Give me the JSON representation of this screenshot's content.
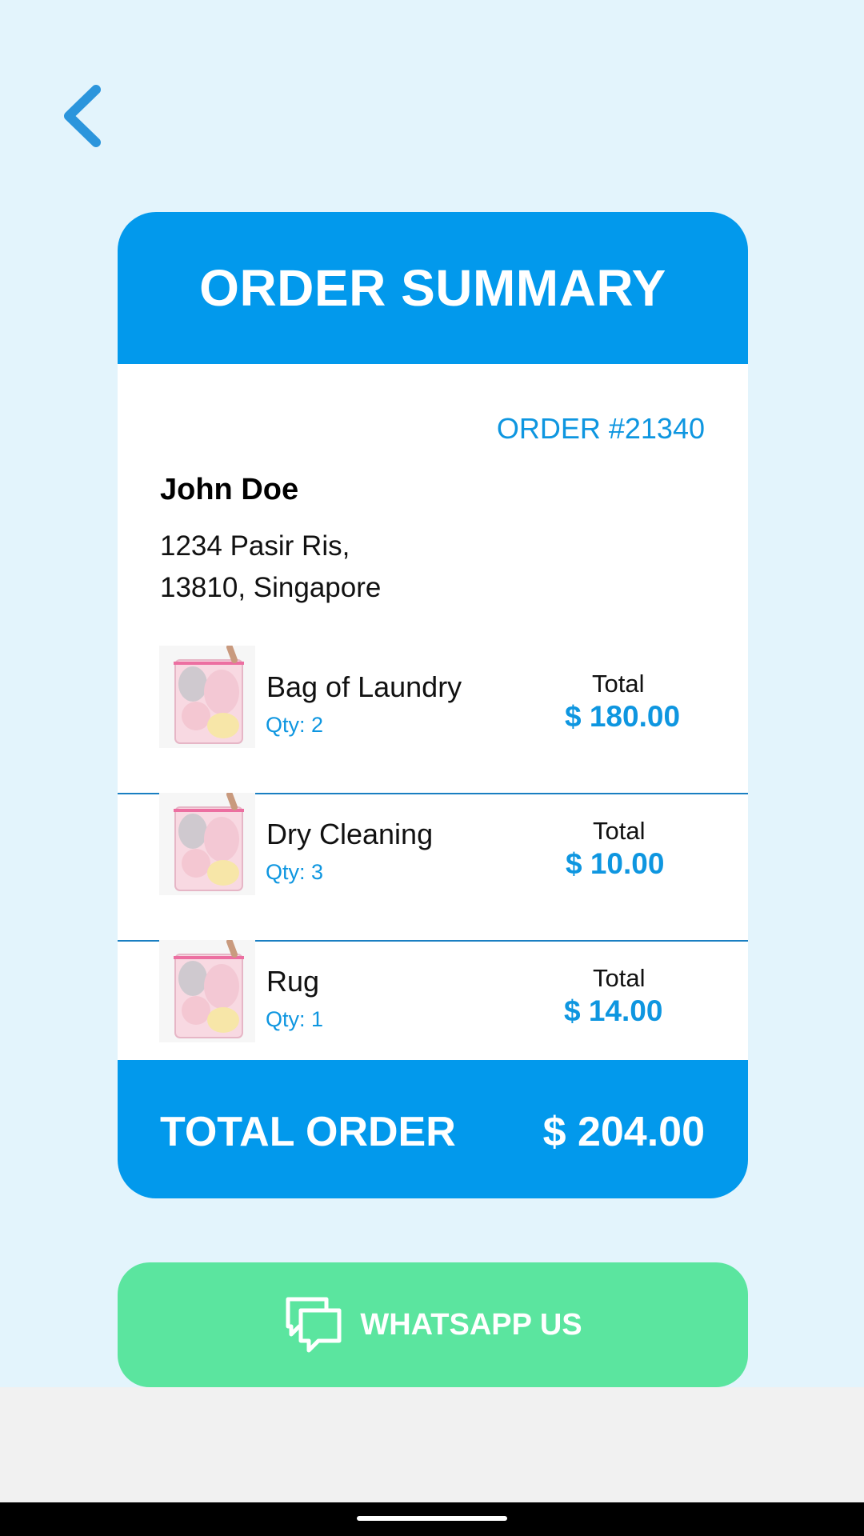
{
  "header": {
    "back_icon": "chevron-left-icon",
    "title": "ORDER SUMMARY"
  },
  "order": {
    "number": "ORDER #21340",
    "customer_name": "John Doe",
    "address_line1": "1234 Pasir Ris,",
    "address_line2": "13810, Singapore"
  },
  "items": [
    {
      "name": "Bag of Laundry",
      "qty": "Qty: 2",
      "total_label": "Total",
      "price": "$ 180.00",
      "image": "laundry-bag-image"
    },
    {
      "name": "Dry Cleaning",
      "qty": "Qty: 3",
      "total_label": "Total",
      "price": "$ 10.00",
      "image": "laundry-bag-image"
    },
    {
      "name": "Rug",
      "qty": "Qty: 1",
      "total_label": "Total",
      "price": "$ 14.00",
      "image": "laundry-bag-image"
    }
  ],
  "footer": {
    "label": "TOTAL ORDER",
    "amount": "$ 204.00"
  },
  "whatsapp": {
    "label": "WHATSAPP US",
    "icon": "chat-icon"
  },
  "colors": {
    "background": "#e3f4fc",
    "primary": "#0299ec",
    "accent_text": "#0e96e0",
    "whatsapp_button": "#5be59f"
  }
}
